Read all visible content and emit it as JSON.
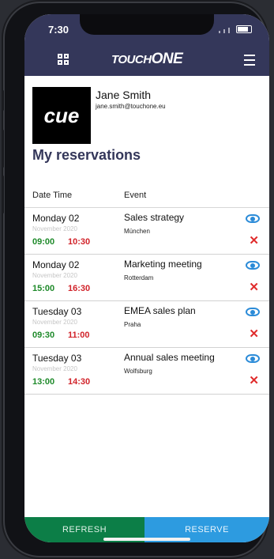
{
  "status": {
    "time": "7:30"
  },
  "header": {
    "logo_prefix": "TOUCH",
    "logo_suffix": "ONE"
  },
  "profile": {
    "logo_text": "cue",
    "name": "Jane Smith",
    "email": "jane.smith@touchone.eu"
  },
  "page_title": "My reservations",
  "table": {
    "col_datetime": "Date Time",
    "col_event": "Event",
    "rows": [
      {
        "day": "Monday 02",
        "month": "November 2020",
        "start": "09:00",
        "end": "10:30",
        "title": "Sales strategy",
        "place": "München"
      },
      {
        "day": "Monday 02",
        "month": "November 2020",
        "start": "15:00",
        "end": "16:30",
        "title": "Marketing meeting",
        "place": "Rotterdam"
      },
      {
        "day": "Tuesday 03",
        "month": "November 2020",
        "start": "09:30",
        "end": "11:00",
        "title": "EMEA sales plan",
        "place": "Praha"
      },
      {
        "day": "Tuesday 03",
        "month": "November 2020",
        "start": "13:00",
        "end": "14:30",
        "title": "Annual sales meeting",
        "place": "Wolfsburg"
      }
    ]
  },
  "footer": {
    "refresh_label": "REFRESH",
    "reserve_label": "RESERVE"
  },
  "colors": {
    "header": "#34375a",
    "refresh": "#0c7e47",
    "reserve": "#2d9be0",
    "start_time": "#1e8a2a",
    "end_time": "#d1232a"
  }
}
